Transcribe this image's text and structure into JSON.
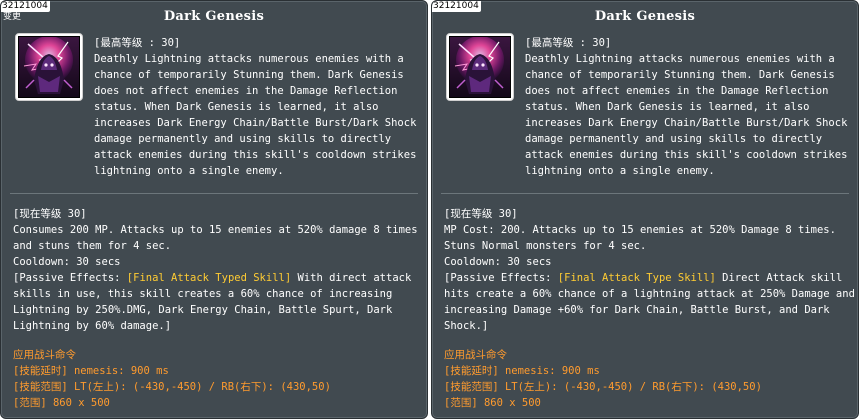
{
  "colors": {
    "panel_bg": "#414a50",
    "text": "#ffffff",
    "highlight": "#ffcc33",
    "command": "#ff9b2e",
    "divider": "#6c767b"
  },
  "left": {
    "skill_id": "32121004",
    "change_note": "变更",
    "title": "Dark Genesis",
    "icon": "dark-genesis-skill-icon",
    "max_level": "[最高等级 : 30]",
    "description": [
      "Deathly Lightning attacks numerous enemies with a",
      "chance of temporarily Stunning them. Dark Genesis",
      "does not affect enemies in the Damage Reflection",
      "status. When Dark Genesis is learned, it also",
      "increases Dark Energy Chain/Battle Burst/Dark Shock",
      "damage permanently and using skills to directly",
      "attack enemies during this skill's cooldown strikes",
      "lightning onto a single enemy."
    ],
    "current_level": "[现在等级 30]",
    "current_lines": [
      "Consumes 200 MP. Attacks up to 15 enemies at 520% damage 8 times",
      "and stuns them for 4 sec.",
      "Cooldown: 30 secs"
    ],
    "passive_prefix": "[Passive Effects: ",
    "passive_highlight": "[Final Attack Typed Skill]",
    "passive_rest_first": " With direct attack",
    "passive_lines": [
      "skills in use, this skill creates a 60% chance of increasing",
      "Lightning by 250%.DMG, Dark Energy Chain, Battle Spurt, Dark",
      "Lightning by 60% damage.]"
    ],
    "command_title": "应用战斗命令",
    "command_lines": [
      "[技能延时] nemesis: 900 ms",
      "[技能范围] LT(左上): (-430,-450) / RB(右下): (430,50)",
      "[范围] 860 x 500"
    ]
  },
  "right": {
    "skill_id": "32121004",
    "title": "Dark Genesis",
    "icon": "dark-genesis-skill-icon",
    "max_level": "[最高等级 : 30]",
    "description": [
      "Deathly Lightning attacks numerous enemies with a",
      "chance of temporarily Stunning them. Dark Genesis",
      "does not affect enemies in the Damage Reflection",
      "status. When Dark Genesis is learned, it also",
      "increases Dark Energy Chain/Battle Burst/Dark Shock",
      "damage permanently and using skills to directly",
      "attack enemies during this skill's cooldown strikes",
      "lightning onto a single enemy."
    ],
    "current_level": "[现在等级 30]",
    "current_lines": [
      "MP Cost: 200. Attacks up to 15 enemies at 520% Damage 8 times.",
      "Stuns Normal monsters for 4 sec.",
      "Cooldown: 30 secs"
    ],
    "passive_prefix": "[Passive Effects: ",
    "passive_highlight": "[Final Attack Type Skill]",
    "passive_rest_first": " Direct Attack skill",
    "passive_lines": [
      "hits create a 60% chance of a lightning attack at 250% Damage and",
      "increasing Damage +60% for Dark Chain, Battle Burst, and Dark",
      "Shock.]"
    ],
    "command_title": "应用战斗命令",
    "command_lines": [
      "[技能延时] nemesis: 900 ms",
      "[技能范围] LT(左上): (-430,-450) / RB(右下): (430,50)",
      "[范围] 860 x 500"
    ]
  }
}
